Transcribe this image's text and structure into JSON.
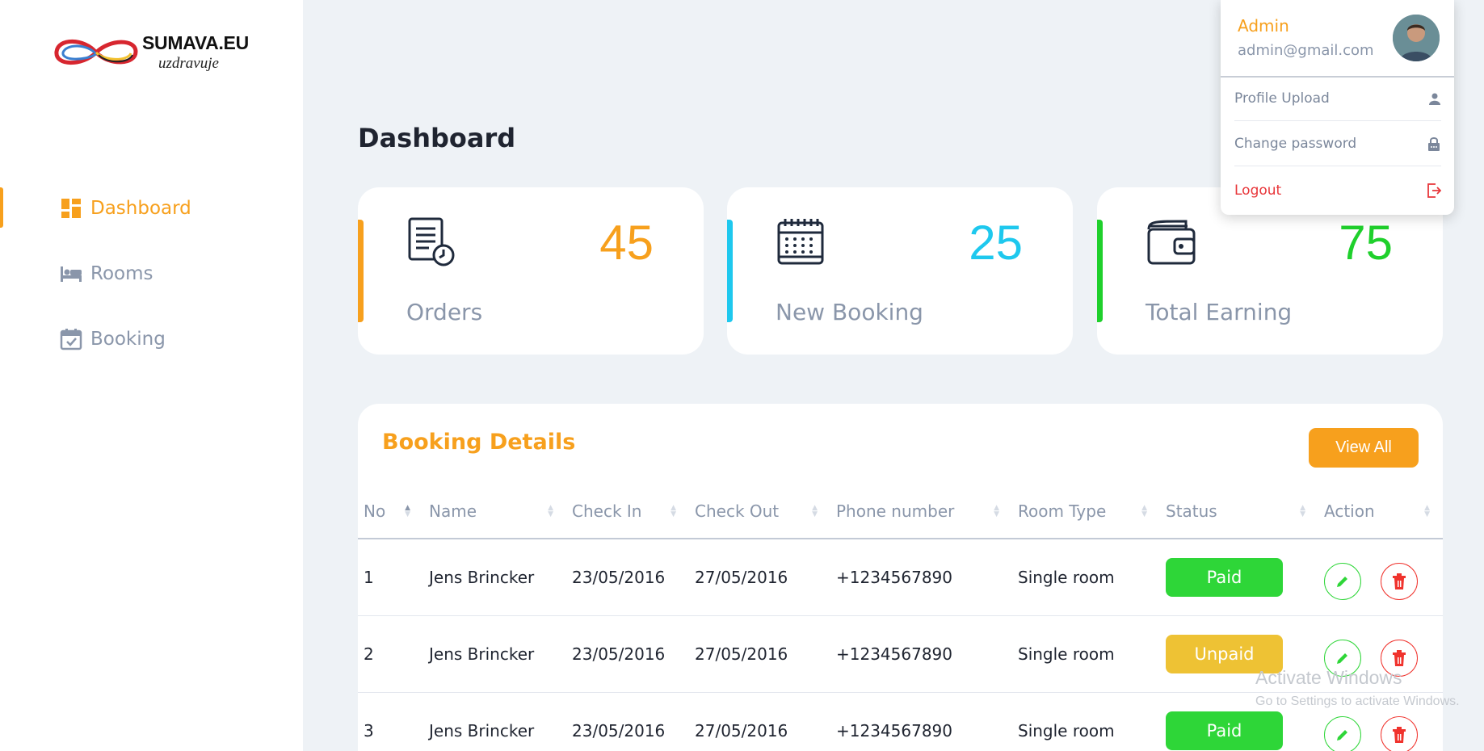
{
  "brand": {
    "name": "SUMAVA.EU",
    "tagline": "uzdravuje"
  },
  "sidebar": {
    "items": [
      {
        "label": "Dashboard",
        "icon": "dashboard-icon",
        "active": true
      },
      {
        "label": "Rooms",
        "icon": "bed-icon",
        "active": false
      },
      {
        "label": "Booking",
        "icon": "calendar-check-icon",
        "active": false
      }
    ]
  },
  "page": {
    "title": "Dashboard"
  },
  "cards": [
    {
      "label": "Orders",
      "value": "45",
      "color": "#f7a01d",
      "icon": "document-clock-icon"
    },
    {
      "label": "New Booking",
      "value": "25",
      "color": "#1ec8ee",
      "icon": "calendar-icon"
    },
    {
      "label": "Total Earning",
      "value": "75",
      "color": "#1fd02c",
      "icon": "wallet-icon"
    }
  ],
  "booking": {
    "title": "Booking Details",
    "view_all": "View All",
    "columns": [
      "No",
      "Name",
      "Check In",
      "Check Out",
      "Phone number",
      "Room Type",
      "Status",
      "Action"
    ],
    "rows": [
      {
        "no": "1",
        "name": "Jens Brincker",
        "check_in": "23/05/2016",
        "check_out": "27/05/2016",
        "phone": "+1234567890",
        "room": "Single room",
        "status": "Paid",
        "status_color": "#2ed638"
      },
      {
        "no": "2",
        "name": "Jens Brincker",
        "check_in": "23/05/2016",
        "check_out": "27/05/2016",
        "phone": "+1234567890",
        "room": "Single room",
        "status": "Unpaid",
        "status_color": "#eec234"
      },
      {
        "no": "3",
        "name": "Jens Brincker",
        "check_in": "23/05/2016",
        "check_out": "27/05/2016",
        "phone": "+1234567890",
        "room": "Single room",
        "status": "Paid",
        "status_color": "#2ed638"
      }
    ]
  },
  "user_menu": {
    "name": "Admin",
    "email": "admin@gmail.com",
    "items": [
      {
        "label": "Profile Upload",
        "icon": "user-icon"
      },
      {
        "label": "Change password",
        "icon": "lock-icon"
      },
      {
        "label": "Logout",
        "icon": "logout-icon"
      }
    ]
  },
  "watermark": {
    "line1": "Activate Windows",
    "line2": "Go to Settings to activate Windows."
  }
}
